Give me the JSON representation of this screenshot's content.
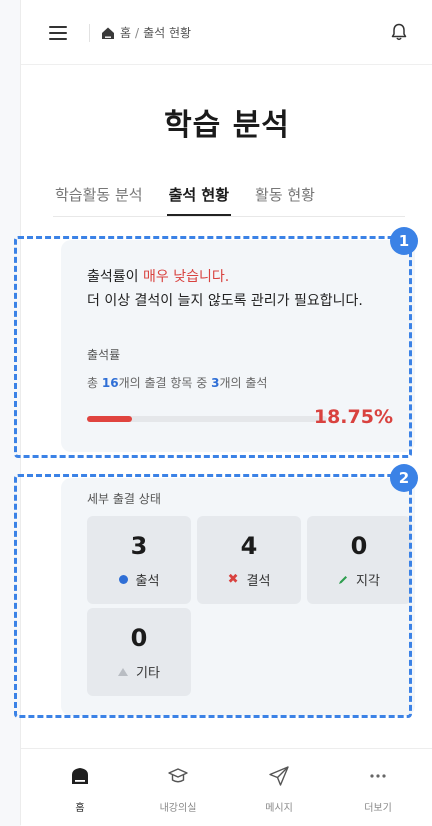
{
  "header": {
    "breadcrumb_home": "홈",
    "breadcrumb_sep": "/",
    "breadcrumb_current": "출석 현황"
  },
  "page": {
    "title": "학습 분석"
  },
  "tabs": [
    {
      "label": "학습활동 분석",
      "active": false
    },
    {
      "label": "출석 현황",
      "active": true
    },
    {
      "label": "활동 현황",
      "active": false
    }
  ],
  "attendance_card": {
    "badge": "1",
    "message_prefix": "출석률이 ",
    "message_warning": "매우 낮습니다.",
    "message_line2": "더 이상 결석이 늘지 않도록 관리가 필요합니다.",
    "rate_label": "출석률",
    "summary_prefix": "총 ",
    "summary_total": "16",
    "summary_mid": "개의 출결 항목 중 ",
    "summary_attended": "3",
    "summary_suffix": "개의 출석",
    "progress_fraction": 0.1875,
    "percent_text": "18.75%"
  },
  "detail_card": {
    "badge": "2",
    "title": "세부 출결 상태",
    "tiles": [
      {
        "count": "3",
        "label": "출석",
        "icon": "blue-dot-icon"
      },
      {
        "count": "4",
        "label": "결석",
        "icon": "red-x-icon"
      },
      {
        "count": "0",
        "label": "지각",
        "icon": "green-pencil-icon"
      },
      {
        "count": "0",
        "label": "기타",
        "icon": "gray-triangle-icon"
      }
    ]
  },
  "bottom_nav": [
    {
      "label": "홈",
      "icon": "home-icon",
      "active": true
    },
    {
      "label": "내강의실",
      "icon": "graduation-cap-icon",
      "active": false
    },
    {
      "label": "메시지",
      "icon": "paper-plane-icon",
      "active": false
    },
    {
      "label": "더보기",
      "icon": "more-dots-icon",
      "active": false
    }
  ],
  "colors": {
    "accent": "#3b82e6",
    "warning": "#d9423f",
    "attended": "#2f6fd6",
    "late": "#2e9e4f"
  }
}
